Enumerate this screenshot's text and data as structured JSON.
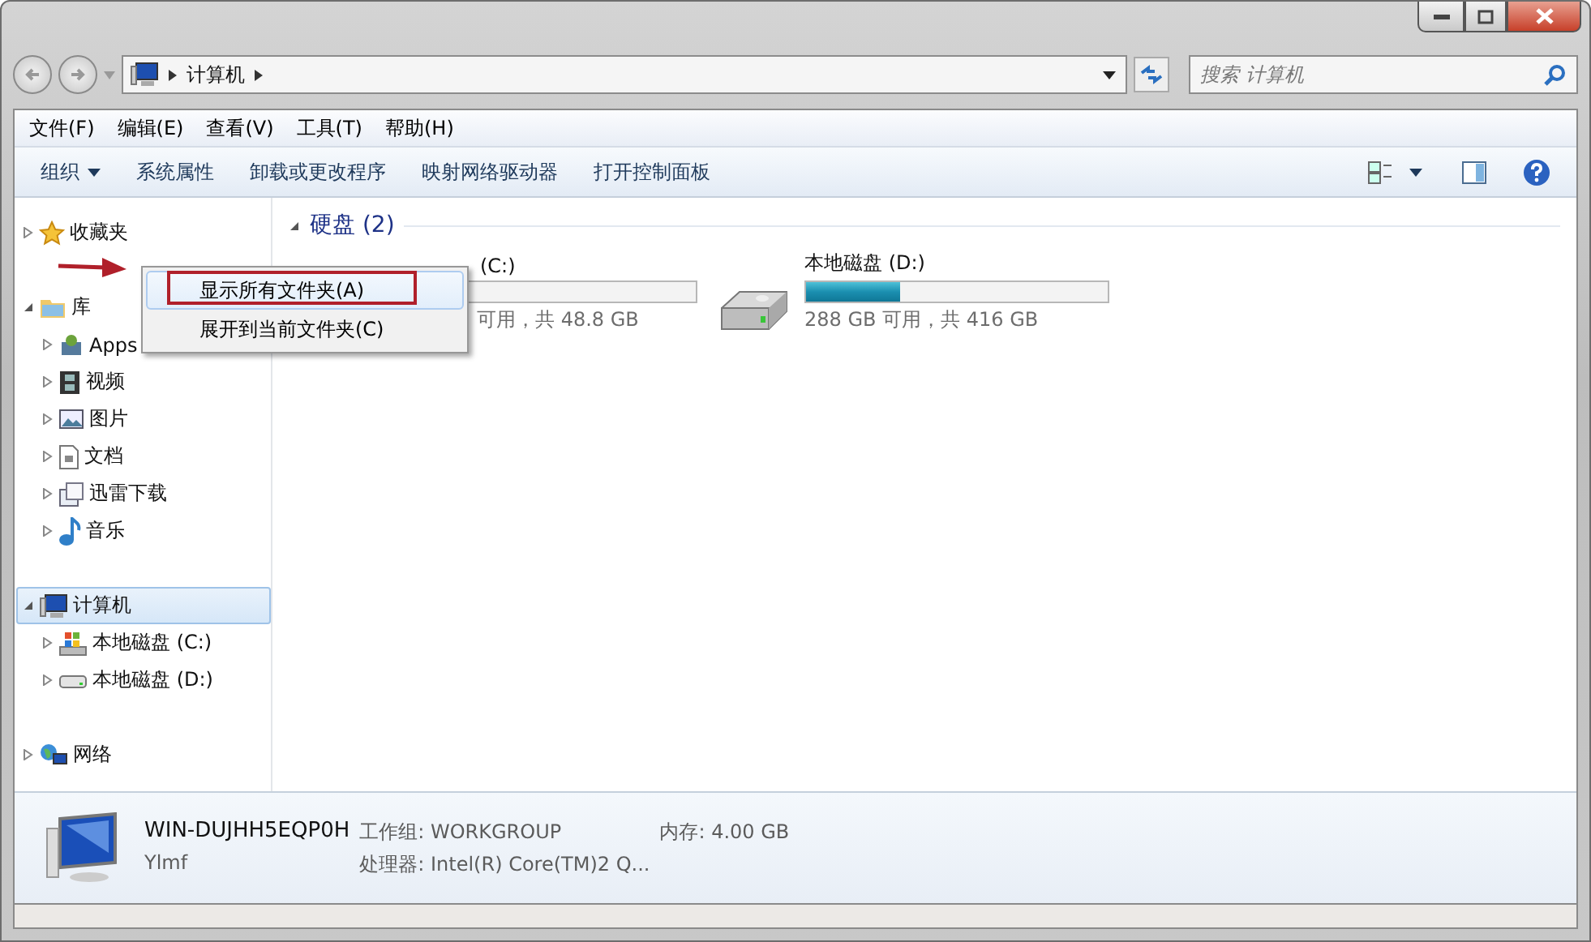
{
  "address": {
    "crumbs": [
      "计算机"
    ],
    "search_placeholder": "搜索 计算机"
  },
  "menu_bar": [
    "文件(F)",
    "编辑(E)",
    "查看(V)",
    "工具(T)",
    "帮助(H)"
  ],
  "toolbar": {
    "buttons": [
      {
        "label": "组织",
        "dropdown": true
      },
      {
        "label": "系统属性",
        "dropdown": false
      },
      {
        "label": "卸载或更改程序",
        "dropdown": false
      },
      {
        "label": "映射网络驱动器",
        "dropdown": false
      },
      {
        "label": "打开控制面板",
        "dropdown": false
      }
    ]
  },
  "sidebar": {
    "groups": [
      {
        "label": "收藏夹",
        "expanded": false,
        "selected": false
      },
      {
        "label": "库",
        "expanded": true,
        "selected": false,
        "children": [
          {
            "label": "Apps"
          },
          {
            "label": "视频"
          },
          {
            "label": "图片"
          },
          {
            "label": "文档"
          },
          {
            "label": "迅雷下载"
          },
          {
            "label": "音乐"
          }
        ]
      },
      {
        "label": "计算机",
        "expanded": true,
        "selected": true,
        "children": [
          {
            "label": "本地磁盘 (C:)"
          },
          {
            "label": "本地磁盘 (D:)"
          }
        ]
      },
      {
        "label": "网络",
        "expanded": false,
        "selected": false
      }
    ]
  },
  "content": {
    "section": "硬盘 (2)",
    "drives": [
      {
        "name": "(C:)",
        "usage": "可用，共 48.8 GB"
      },
      {
        "name": "本地磁盘 (D:)",
        "level": 0.31,
        "usage": "288 GB 可用，共 416 GB"
      }
    ]
  },
  "context_menu": {
    "items": [
      {
        "label": "显示所有文件夹(A)",
        "selected": true
      },
      {
        "label": "展开到当前文件夹(C)",
        "selected": false
      }
    ]
  },
  "details": {
    "name": "WIN-DUJHH5EQP0H",
    "user": "Ylmf",
    "fields": [
      {
        "text": "工作组: WORKGROUP"
      },
      {
        "text": "内存: 4.00 GB"
      },
      {
        "text": "处理器: Intel(R) Core(TM)2 Q..."
      }
    ]
  }
}
